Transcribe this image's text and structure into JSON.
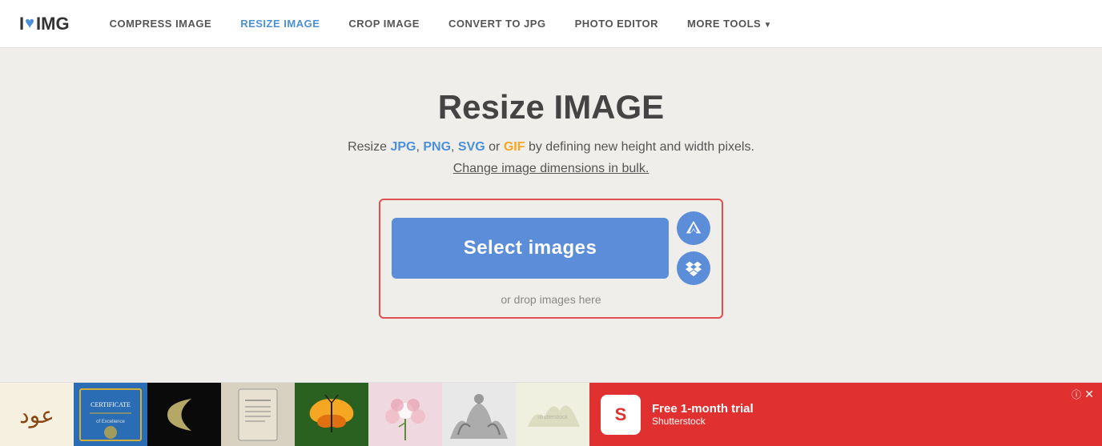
{
  "header": {
    "logo": {
      "text_i": "I",
      "heart": "♥",
      "text_img": "IMG"
    },
    "nav": [
      {
        "id": "compress",
        "label": "COMPRESS IMAGE",
        "active": false
      },
      {
        "id": "resize",
        "label": "RESIZE IMAGE",
        "active": true
      },
      {
        "id": "crop",
        "label": "CROP IMAGE",
        "active": false
      },
      {
        "id": "convert",
        "label": "CONVERT TO JPG",
        "active": false
      },
      {
        "id": "photo",
        "label": "PHOTO EDITOR",
        "active": false
      },
      {
        "id": "more",
        "label": "MORE TOOLS",
        "active": false,
        "arrow": true
      }
    ]
  },
  "main": {
    "title": "Resize IMAGE",
    "subtitle_line1": "Resize ",
    "formats": [
      {
        "label": "JPG",
        "color": "blue"
      },
      {
        "label": "PNG",
        "color": "blue"
      },
      {
        "label": "SVG",
        "color": "blue"
      },
      {
        "label": "GIF",
        "color": "orange"
      }
    ],
    "subtitle_mid": " by defining new height and width pixels.",
    "subtitle_line2": "Change image dimensions in bulk.",
    "select_btn": "Select images",
    "drop_text": "or drop images here",
    "cloud_icon": "☁",
    "dropbox_icon": "◆"
  },
  "ad": {
    "title": "Free 1-month trial",
    "subtitle": "Shutterstock",
    "icon_text": "S",
    "info": "ⓘ",
    "close": "✕"
  },
  "colors": {
    "accent": "#5b8dd9",
    "active_nav": "#4a90d9",
    "red_border": "#e05050",
    "ad_red": "#e03030"
  }
}
